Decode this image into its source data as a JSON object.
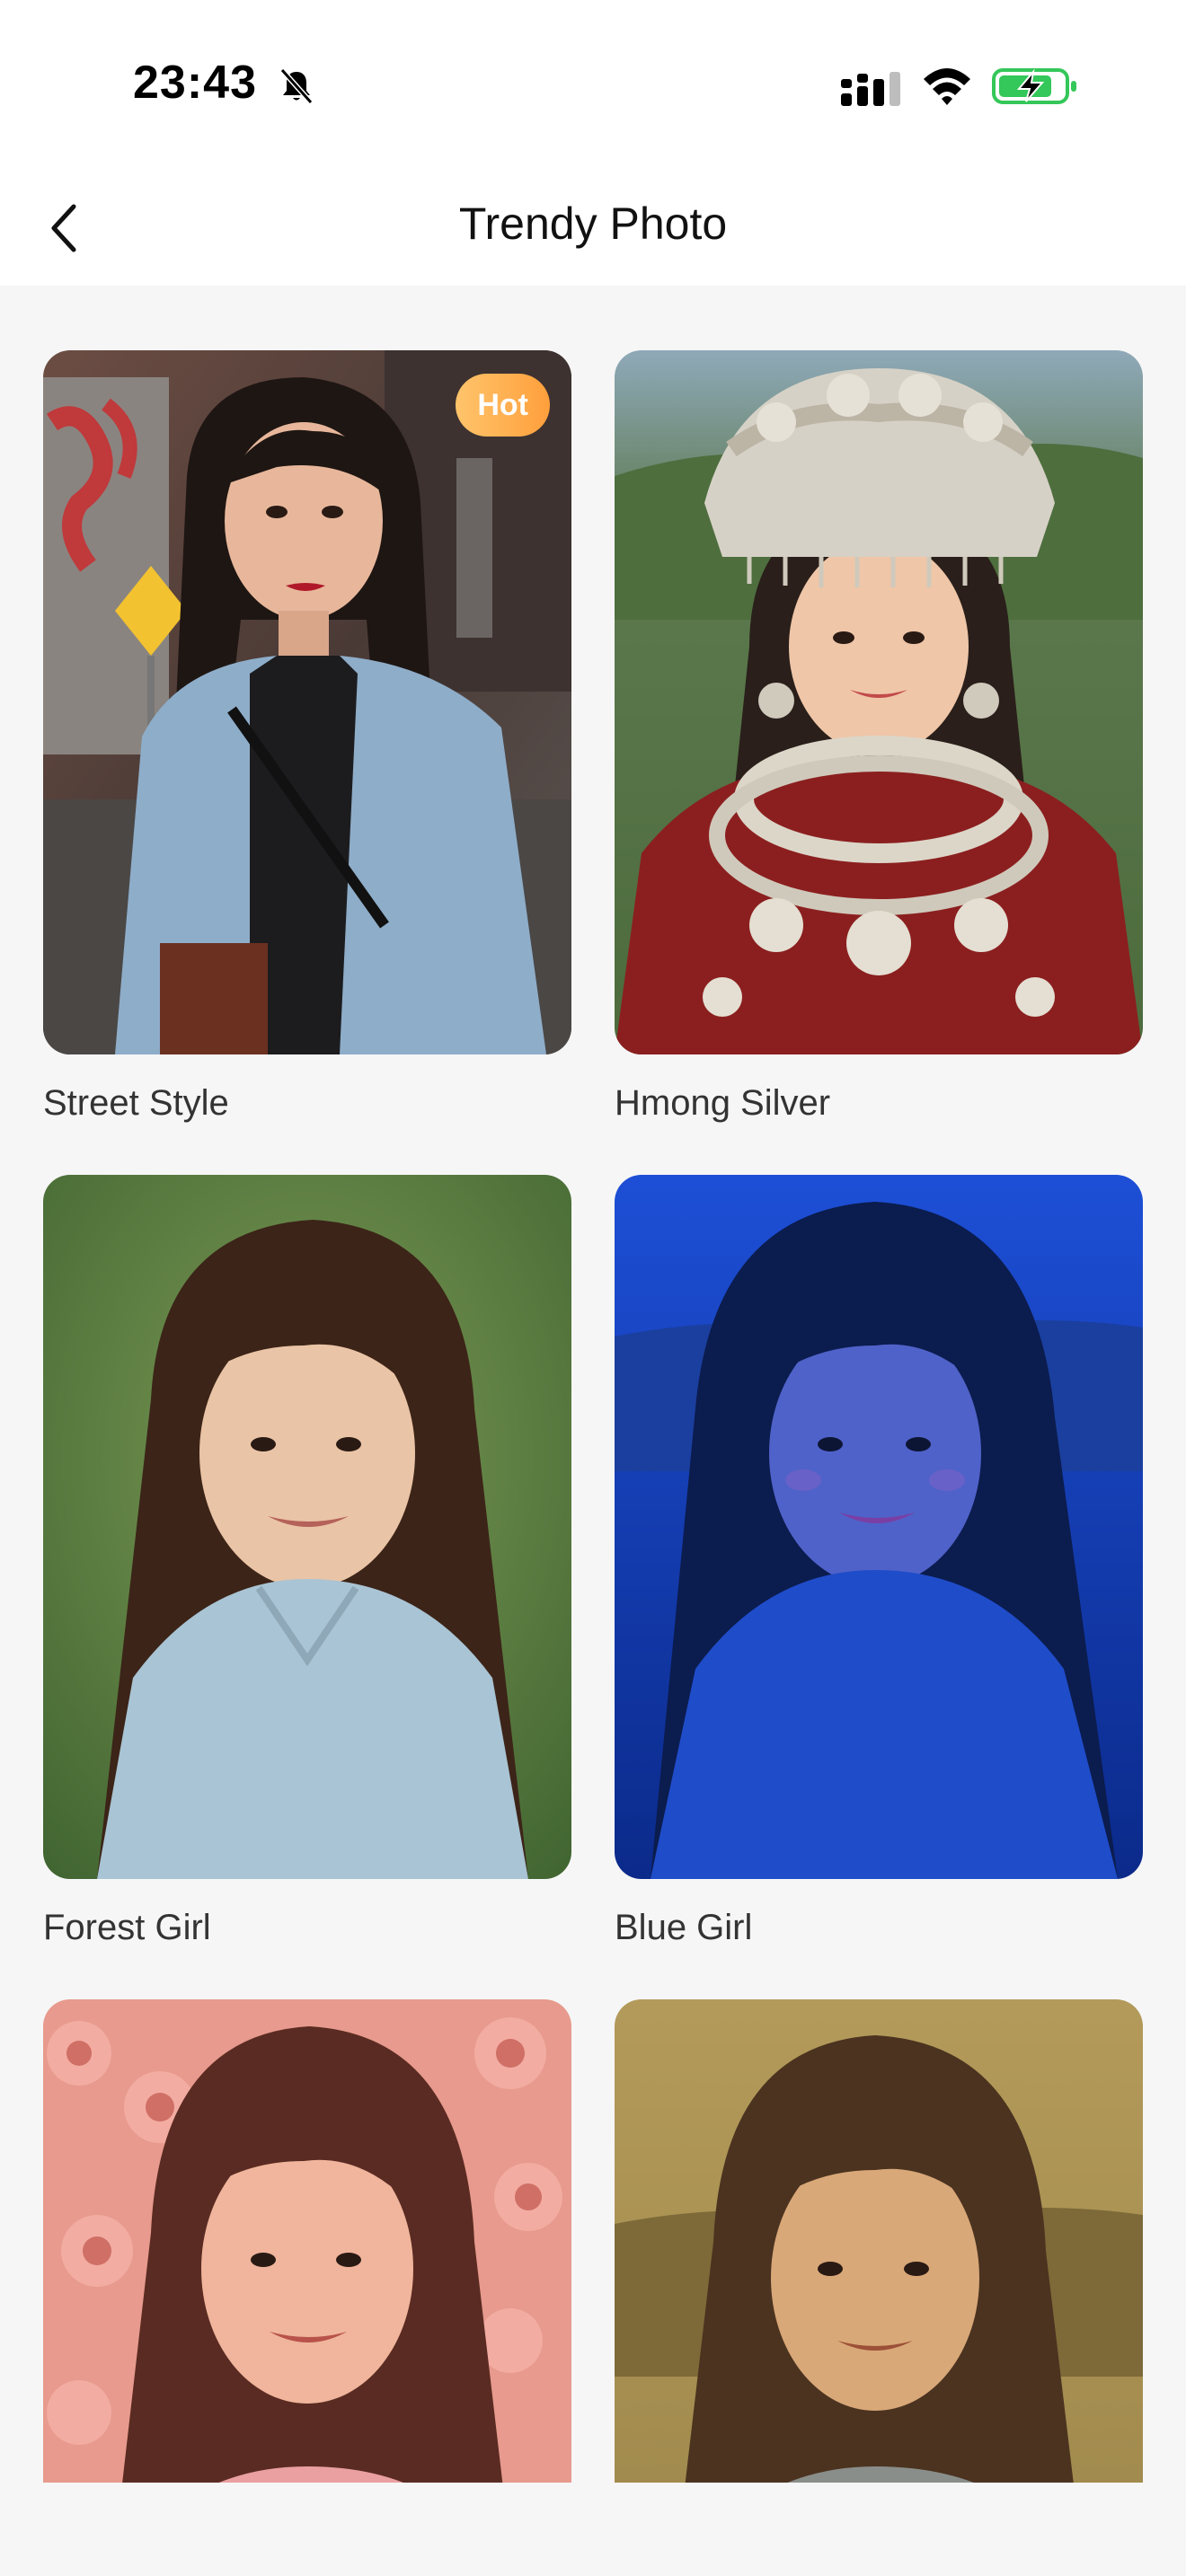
{
  "status_bar": {
    "time": "23:43"
  },
  "nav": {
    "title": "Trendy Photo"
  },
  "items": [
    {
      "label": "Street Style",
      "badge": "Hot"
    },
    {
      "label": "Hmong Silver"
    },
    {
      "label": "Forest Girl"
    },
    {
      "label": "Blue Girl"
    },
    {
      "label": "",
      "partial": true
    },
    {
      "label": "",
      "partial": true
    }
  ],
  "colors": {
    "badge_start": "#ffc46b",
    "badge_end": "#ff9f3c",
    "battery_fill": "#34c759"
  }
}
